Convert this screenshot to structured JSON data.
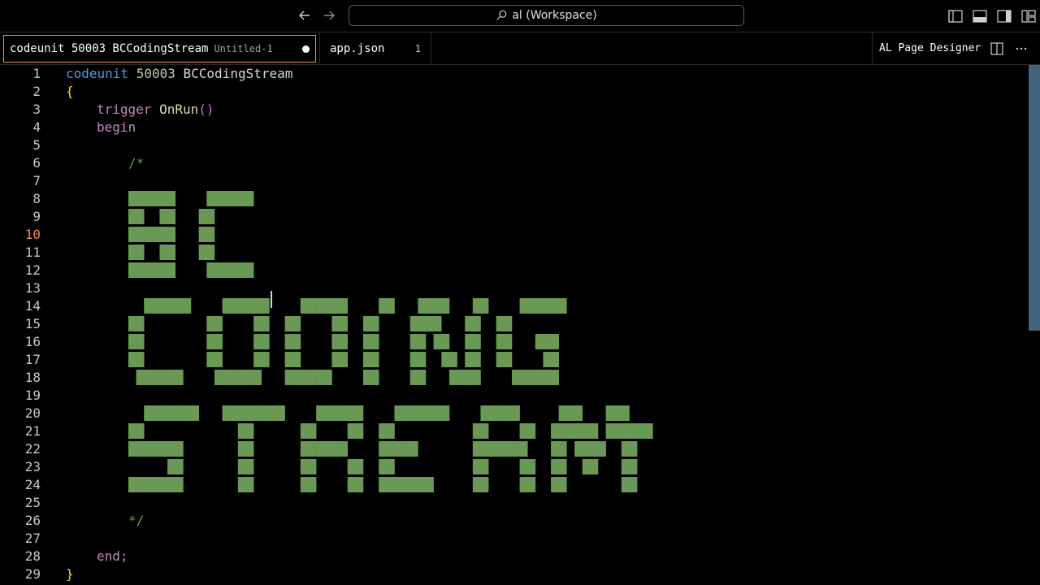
{
  "titlebar": {
    "search_text": "al (Workspace)"
  },
  "tabs": [
    {
      "title": "codeunit 50003 BCCodingStream",
      "description": "Untitled-1"
    },
    {
      "title": "app.json",
      "badge": "1"
    }
  ],
  "right_panel": {
    "label": "AL Page Designer"
  },
  "editor": {
    "active_line": 10,
    "lines": [
      {
        "n": "1"
      },
      {
        "n": "2"
      },
      {
        "n": "3"
      },
      {
        "n": "4"
      },
      {
        "n": "5"
      },
      {
        "n": "6"
      },
      {
        "n": "7"
      },
      {
        "n": "8"
      },
      {
        "n": "9"
      },
      {
        "n": "10"
      },
      {
        "n": "11"
      },
      {
        "n": "12"
      },
      {
        "n": "13"
      },
      {
        "n": "14"
      },
      {
        "n": "15"
      },
      {
        "n": "16"
      },
      {
        "n": "17"
      },
      {
        "n": "18"
      },
      {
        "n": "19"
      },
      {
        "n": "20"
      },
      {
        "n": "21"
      },
      {
        "n": "22"
      },
      {
        "n": "23"
      },
      {
        "n": "24"
      },
      {
        "n": "25"
      },
      {
        "n": "26"
      },
      {
        "n": "27"
      },
      {
        "n": "28"
      },
      {
        "n": "29"
      }
    ],
    "code": {
      "l1_kw": "codeunit",
      "l1_num": "50003",
      "l1_name": "BCCodingStream",
      "l2": "{",
      "l3_kw": "trigger",
      "l3_fn": "OnRun",
      "l3_paren": "()",
      "l4": "begin",
      "l6": "/*",
      "art": [
        "██████    ██████",
        "██  ██   ██",
        "██████   ██",
        "██  ██   ██",
        "██████    ██████",
        "",
        "  ██████    ██████    ██████    ██   ████   ██    ██████",
        "██        ██    ██  ██    ██  ██    ████   ██  ██",
        "██        ██    ██  ██    ██  ██    ██ ██  ██  ██   ███",
        "██        ██    ██  ██    ██  ██    ██  ██ ██  ██    ██",
        " ██████    ██████   ██████    ██    ██   ████    ██████",
        "",
        "  ███████   ████████    ██████    ███████    █████     ███   ███",
        "██            ██      ██    ██  ██          ██    ██  ██████ ██████",
        "███████       ██      ██████    █████       ███████   ██ ████  ██",
        "     ██       ██      ██    ██  ██          ██    ██  ██  ██   ██",
        "███████       ██      ██    ██  ███████     ██    ██  ██       ██"
      ],
      "l26": "*/",
      "l28": "end;",
      "l29": "}"
    }
  },
  "colors": {
    "keyword": "#569cd6",
    "control": "#c586c0",
    "number": "#b5cea8",
    "comment": "#6a9955",
    "active_line_number": "#f0875f",
    "tab_border": "#f08c78",
    "scroll_thumb": "#4a6f8a"
  },
  "icons": [
    "arrow-left-icon",
    "arrow-right-icon",
    "search-icon",
    "toggle-primary-sidebar-icon",
    "toggle-panel-icon",
    "toggle-secondary-sidebar-icon",
    "customize-layout-icon",
    "split-editor-icon",
    "more-actions-icon",
    "modified-dot-icon"
  ]
}
